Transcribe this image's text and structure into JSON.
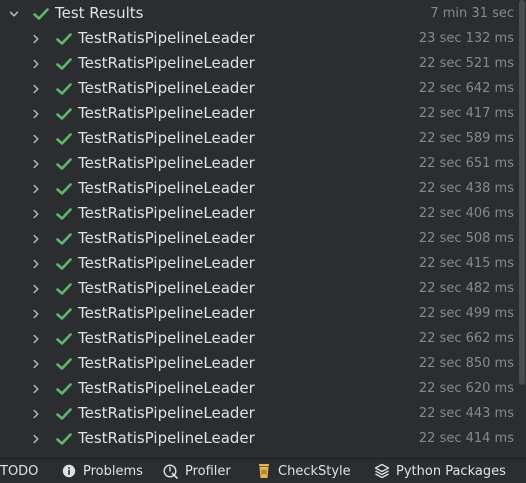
{
  "root": {
    "label": "Test Results",
    "duration": "7 min 31 sec",
    "status": "passed"
  },
  "tests": [
    {
      "name": "TestRatisPipelineLeader",
      "duration": "23 sec 132 ms"
    },
    {
      "name": "TestRatisPipelineLeader",
      "duration": "22 sec 521 ms"
    },
    {
      "name": "TestRatisPipelineLeader",
      "duration": "22 sec 642 ms"
    },
    {
      "name": "TestRatisPipelineLeader",
      "duration": "22 sec 417 ms"
    },
    {
      "name": "TestRatisPipelineLeader",
      "duration": "22 sec 589 ms"
    },
    {
      "name": "TestRatisPipelineLeader",
      "duration": "22 sec 651 ms"
    },
    {
      "name": "TestRatisPipelineLeader",
      "duration": "22 sec 438 ms"
    },
    {
      "name": "TestRatisPipelineLeader",
      "duration": "22 sec 406 ms"
    },
    {
      "name": "TestRatisPipelineLeader",
      "duration": "22 sec 508 ms"
    },
    {
      "name": "TestRatisPipelineLeader",
      "duration": "22 sec 415 ms"
    },
    {
      "name": "TestRatisPipelineLeader",
      "duration": "22 sec 482 ms"
    },
    {
      "name": "TestRatisPipelineLeader",
      "duration": "22 sec 499 ms"
    },
    {
      "name": "TestRatisPipelineLeader",
      "duration": "22 sec 662 ms"
    },
    {
      "name": "TestRatisPipelineLeader",
      "duration": "22 sec 850 ms"
    },
    {
      "name": "TestRatisPipelineLeader",
      "duration": "22 sec 620 ms"
    },
    {
      "name": "TestRatisPipelineLeader",
      "duration": "22 sec 443 ms"
    },
    {
      "name": "TestRatisPipelineLeader",
      "duration": "22 sec 414 ms"
    }
  ],
  "toolbar": {
    "todo": "TODO",
    "problems": "Problems",
    "profiler": "Profiler",
    "checkstyle": "CheckStyle",
    "python_packages": "Python Packages"
  },
  "colors": {
    "background": "#2b2d30",
    "pass_green": "#5fb865",
    "text": "#dfe1e5",
    "muted": "#868a91",
    "checkstyle_yellow": "#e8b84a"
  },
  "icons": {
    "expand": "chevron-down-icon",
    "collapsed": "chevron-right-icon",
    "passed": "check-icon",
    "problems": "info-circle-icon",
    "profiler": "profiler-icon",
    "checkstyle": "checkstyle-cup-icon",
    "python_packages": "layers-icon"
  }
}
